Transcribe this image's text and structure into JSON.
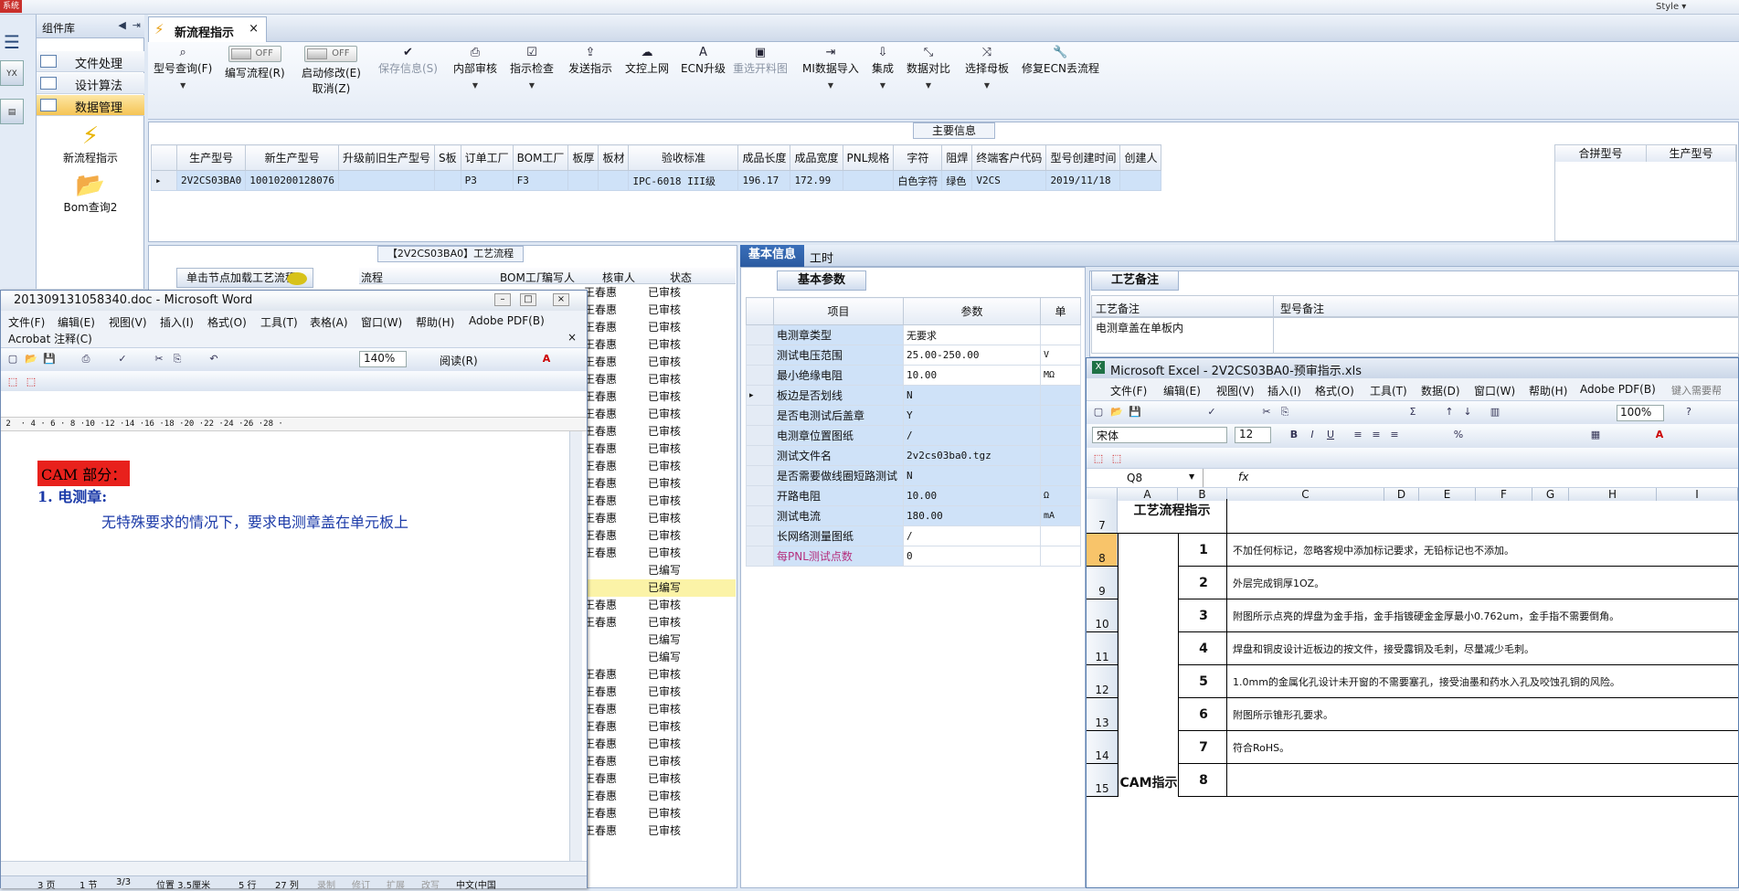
{
  "top": {
    "system_badge": "系统",
    "style_label": "Style ▾"
  },
  "components": {
    "title": "组件库",
    "items": [
      "文件处理",
      "设计算法",
      "数据管理"
    ],
    "big": [
      "新流程指示",
      "Bom查询2"
    ]
  },
  "tab": {
    "label": "新流程指示",
    "close": "×"
  },
  "ribbon": {
    "items": [
      {
        "icon": "search-icon",
        "label": "型号查询(F)"
      },
      {
        "label": "编写流程(R)",
        "toggle": "OFF"
      },
      {
        "label": "启动修改(E)",
        "sub": "取消(Z)",
        "toggle": "OFF"
      },
      {
        "icon": "check-icon",
        "label": "保存信息(S)"
      },
      {
        "icon": "print-icon",
        "label": "内部审核"
      },
      {
        "icon": "checkbox-icon",
        "label": "指示检查"
      },
      {
        "icon": "upload-icon",
        "label": "发送指示"
      },
      {
        "icon": "cloud-icon",
        "label": "文控上网"
      },
      {
        "icon": "letter-a-icon",
        "label": "ECN升级"
      },
      {
        "icon": "image-icon",
        "label": "重选开料图"
      },
      {
        "icon": "mi-import-icon",
        "label": "MI数据导入"
      },
      {
        "icon": "download-icon",
        "label": "集成"
      },
      {
        "icon": "wand-icon",
        "label": "数据对比"
      },
      {
        "icon": "shuffle-icon",
        "label": "选择母板"
      },
      {
        "icon": "wrench-icon",
        "label": "修复ECN丢流程"
      }
    ]
  },
  "main": {
    "caption": "主要信息",
    "columns": [
      "生产型号",
      "新生产型号",
      "升级前旧生产型号",
      "S板",
      "订单工厂",
      "BOM工厂",
      "板厚",
      "板材",
      "验收标准",
      "成品长度",
      "成品宽度",
      "PNL规格",
      "字符",
      "阻焊",
      "终端客户代码",
      "型号创建时间",
      "创建人"
    ],
    "row": [
      "2V2CS03BA0",
      "10010200128076",
      "",
      "",
      "P3",
      "F3",
      "",
      "",
      "IPC-6018 III级",
      "196.17",
      "172.99",
      "",
      "白色字符",
      "绿色",
      "V2CS",
      "2019/11/18",
      ""
    ],
    "right_cols": [
      "合拼型号",
      "生产型号"
    ]
  },
  "flow": {
    "caption": "【2V2CS03BA0】工艺流程",
    "load_node": "单击节点加载工艺流程",
    "headers": [
      "流程",
      "BOM工厂",
      "编写人",
      "核审人",
      "状态"
    ],
    "rows": [
      {
        "r": "王春惠",
        "s": "已审核"
      },
      {
        "r": "王春惠",
        "s": "已审核"
      },
      {
        "r": "王春惠",
        "s": "已审核"
      },
      {
        "r": "王春惠",
        "s": "已审核"
      },
      {
        "r": "王春惠",
        "s": "已审核"
      },
      {
        "r": "王春惠",
        "s": "已审核"
      },
      {
        "r": "王春惠",
        "s": "已审核"
      },
      {
        "r": "王春惠",
        "s": "已审核"
      },
      {
        "r": "王春惠",
        "s": "已审核"
      },
      {
        "r": "王春惠",
        "s": "已审核"
      },
      {
        "r": "王春惠",
        "s": "已审核"
      },
      {
        "r": "王春惠",
        "s": "已审核"
      },
      {
        "r": "王春惠",
        "s": "已审核"
      },
      {
        "r": "王春惠",
        "s": "已审核"
      },
      {
        "r": "王春惠",
        "s": "已审核"
      },
      {
        "r": "王春惠",
        "s": "已审核"
      },
      {
        "r": "",
        "s": "已编写"
      },
      {
        "r": "",
        "s": "已编写",
        "hl": true
      },
      {
        "r": "王春惠",
        "s": "已审核"
      },
      {
        "r": "王春惠",
        "s": "已审核"
      },
      {
        "r": "",
        "s": "已编写"
      },
      {
        "r": "",
        "s": "已编写"
      },
      {
        "r": "王春惠",
        "s": "已审核"
      },
      {
        "r": "王春惠",
        "s": "已审核"
      },
      {
        "r": "王春惠",
        "s": "已审核"
      },
      {
        "r": "王春惠",
        "s": "已审核"
      },
      {
        "r": "王春惠",
        "s": "已审核"
      },
      {
        "r": "王春惠",
        "s": "已审核"
      },
      {
        "r": "王春惠",
        "s": "已审核"
      },
      {
        "r": "王春惠",
        "s": "已审核"
      },
      {
        "r": "王春惠",
        "s": "已审核"
      },
      {
        "r": "王春惠",
        "s": "已审核"
      }
    ]
  },
  "word": {
    "title": "201309131058340.doc - Microsoft Word",
    "menu": [
      "文件(F)",
      "编辑(E)",
      "视图(V)",
      "插入(I)",
      "格式(O)",
      "工具(T)",
      "表格(A)",
      "窗口(W)",
      "帮助(H)",
      "Adobe PDF(B)"
    ],
    "menu2": "Acrobat 注释(C)",
    "zoom": "140%",
    "read": "阅读(R)",
    "ruler": " 2  · 4 · 6 · 8 ·10 ·12 ·14 ·16 ·18 ·20 ·22 ·24 ·26 ·28 ·",
    "cam_heading": "CAM 部分：",
    "line1": "1. 电测章:",
    "line2": "无特殊要求的情况下，要求电测章盖在单元板上",
    "status": [
      "3 页",
      "1 节",
      "3/3",
      "位置 3.5厘米",
      "5 行",
      "27 列",
      "录制",
      "修订",
      "扩展",
      "改写",
      "中文(中国"
    ]
  },
  "basic": {
    "tab_basic": "基本信息",
    "tab_work": "工时",
    "caption": "基本参数",
    "headers": [
      "项目",
      "参数",
      "单"
    ],
    "rows": [
      {
        "k": "电测章类型",
        "v": "无要求",
        "u": ""
      },
      {
        "k": "测试电压范围",
        "v": "25.00-250.00",
        "u": "V"
      },
      {
        "k": "最小绝缘电阻",
        "v": "10.00",
        "u": "MΩ"
      },
      {
        "k": "板边是否划线",
        "v": "N",
        "u": ""
      },
      {
        "k": "是否电测试后盖章",
        "v": "Y",
        "u": ""
      },
      {
        "k": "电测章位置图纸",
        "v": "/",
        "u": ""
      },
      {
        "k": "测试文件名",
        "v": "2v2cs03ba0.tgz",
        "u": ""
      },
      {
        "k": "是否需要做线圈短路测试",
        "v": "N",
        "u": ""
      },
      {
        "k": "开路电阻",
        "v": "10.00",
        "u": "Ω"
      },
      {
        "k": "测试电流",
        "v": "180.00",
        "u": "mA"
      },
      {
        "k": "长网络测量图纸",
        "v": "/",
        "u": ""
      },
      {
        "k": "每PNL测试点数",
        "v": "0",
        "u": ""
      }
    ]
  },
  "remark": {
    "caption": "工艺备注",
    "col1": "工艺备注",
    "col2": "型号备注",
    "value": "电测章盖在单板内"
  },
  "excel": {
    "title": "Microsoft Excel - 2V2CS03BA0-预审指示.xls",
    "menu": [
      "文件(F)",
      "编辑(E)",
      "视图(V)",
      "插入(I)",
      "格式(O)",
      "工具(T)",
      "数据(D)",
      "窗口(W)",
      "帮助(H)",
      "Adobe PDF(B)"
    ],
    "help_box": "键入需要帮",
    "zoom": "100%",
    "font": "宋体",
    "size": "12",
    "cell_ref": "Q8",
    "fx": "fx",
    "columns": [
      "A",
      "B",
      "C",
      "D",
      "E",
      "F",
      "G",
      "H",
      "I"
    ],
    "flow_title": "工艺流程指示",
    "cam_label": "CAM指示",
    "rows": [
      {
        "n": "1",
        "t": "不加任何标记，忽略客规中添加标记要求，无铅标记也不添加。"
      },
      {
        "n": "2",
        "t": "外层完成铜厚1OZ。"
      },
      {
        "n": "3",
        "t": "附图所示点亮的焊盘为金手指，金手指镀硬金金厚最小0.762um，金手指不需要倒角。"
      },
      {
        "n": "4",
        "t": "焊盘和铜皮设计近板边的按文件，接受露铜及毛刺，尽量减少毛刺。"
      },
      {
        "n": "5",
        "t": "1.0mm的金属化孔设计未开窗的不需要塞孔，接受油墨和药水入孔及咬蚀孔铜的风险。"
      },
      {
        "n": "6",
        "t": "附图所示锥形孔要求。"
      },
      {
        "n": "7",
        "t": "符合RoHS。"
      },
      {
        "n": "8",
        "t": ""
      }
    ],
    "row_numbers": [
      "7",
      "8",
      "9",
      "10",
      "11",
      "12",
      "13",
      "14",
      "15"
    ]
  }
}
